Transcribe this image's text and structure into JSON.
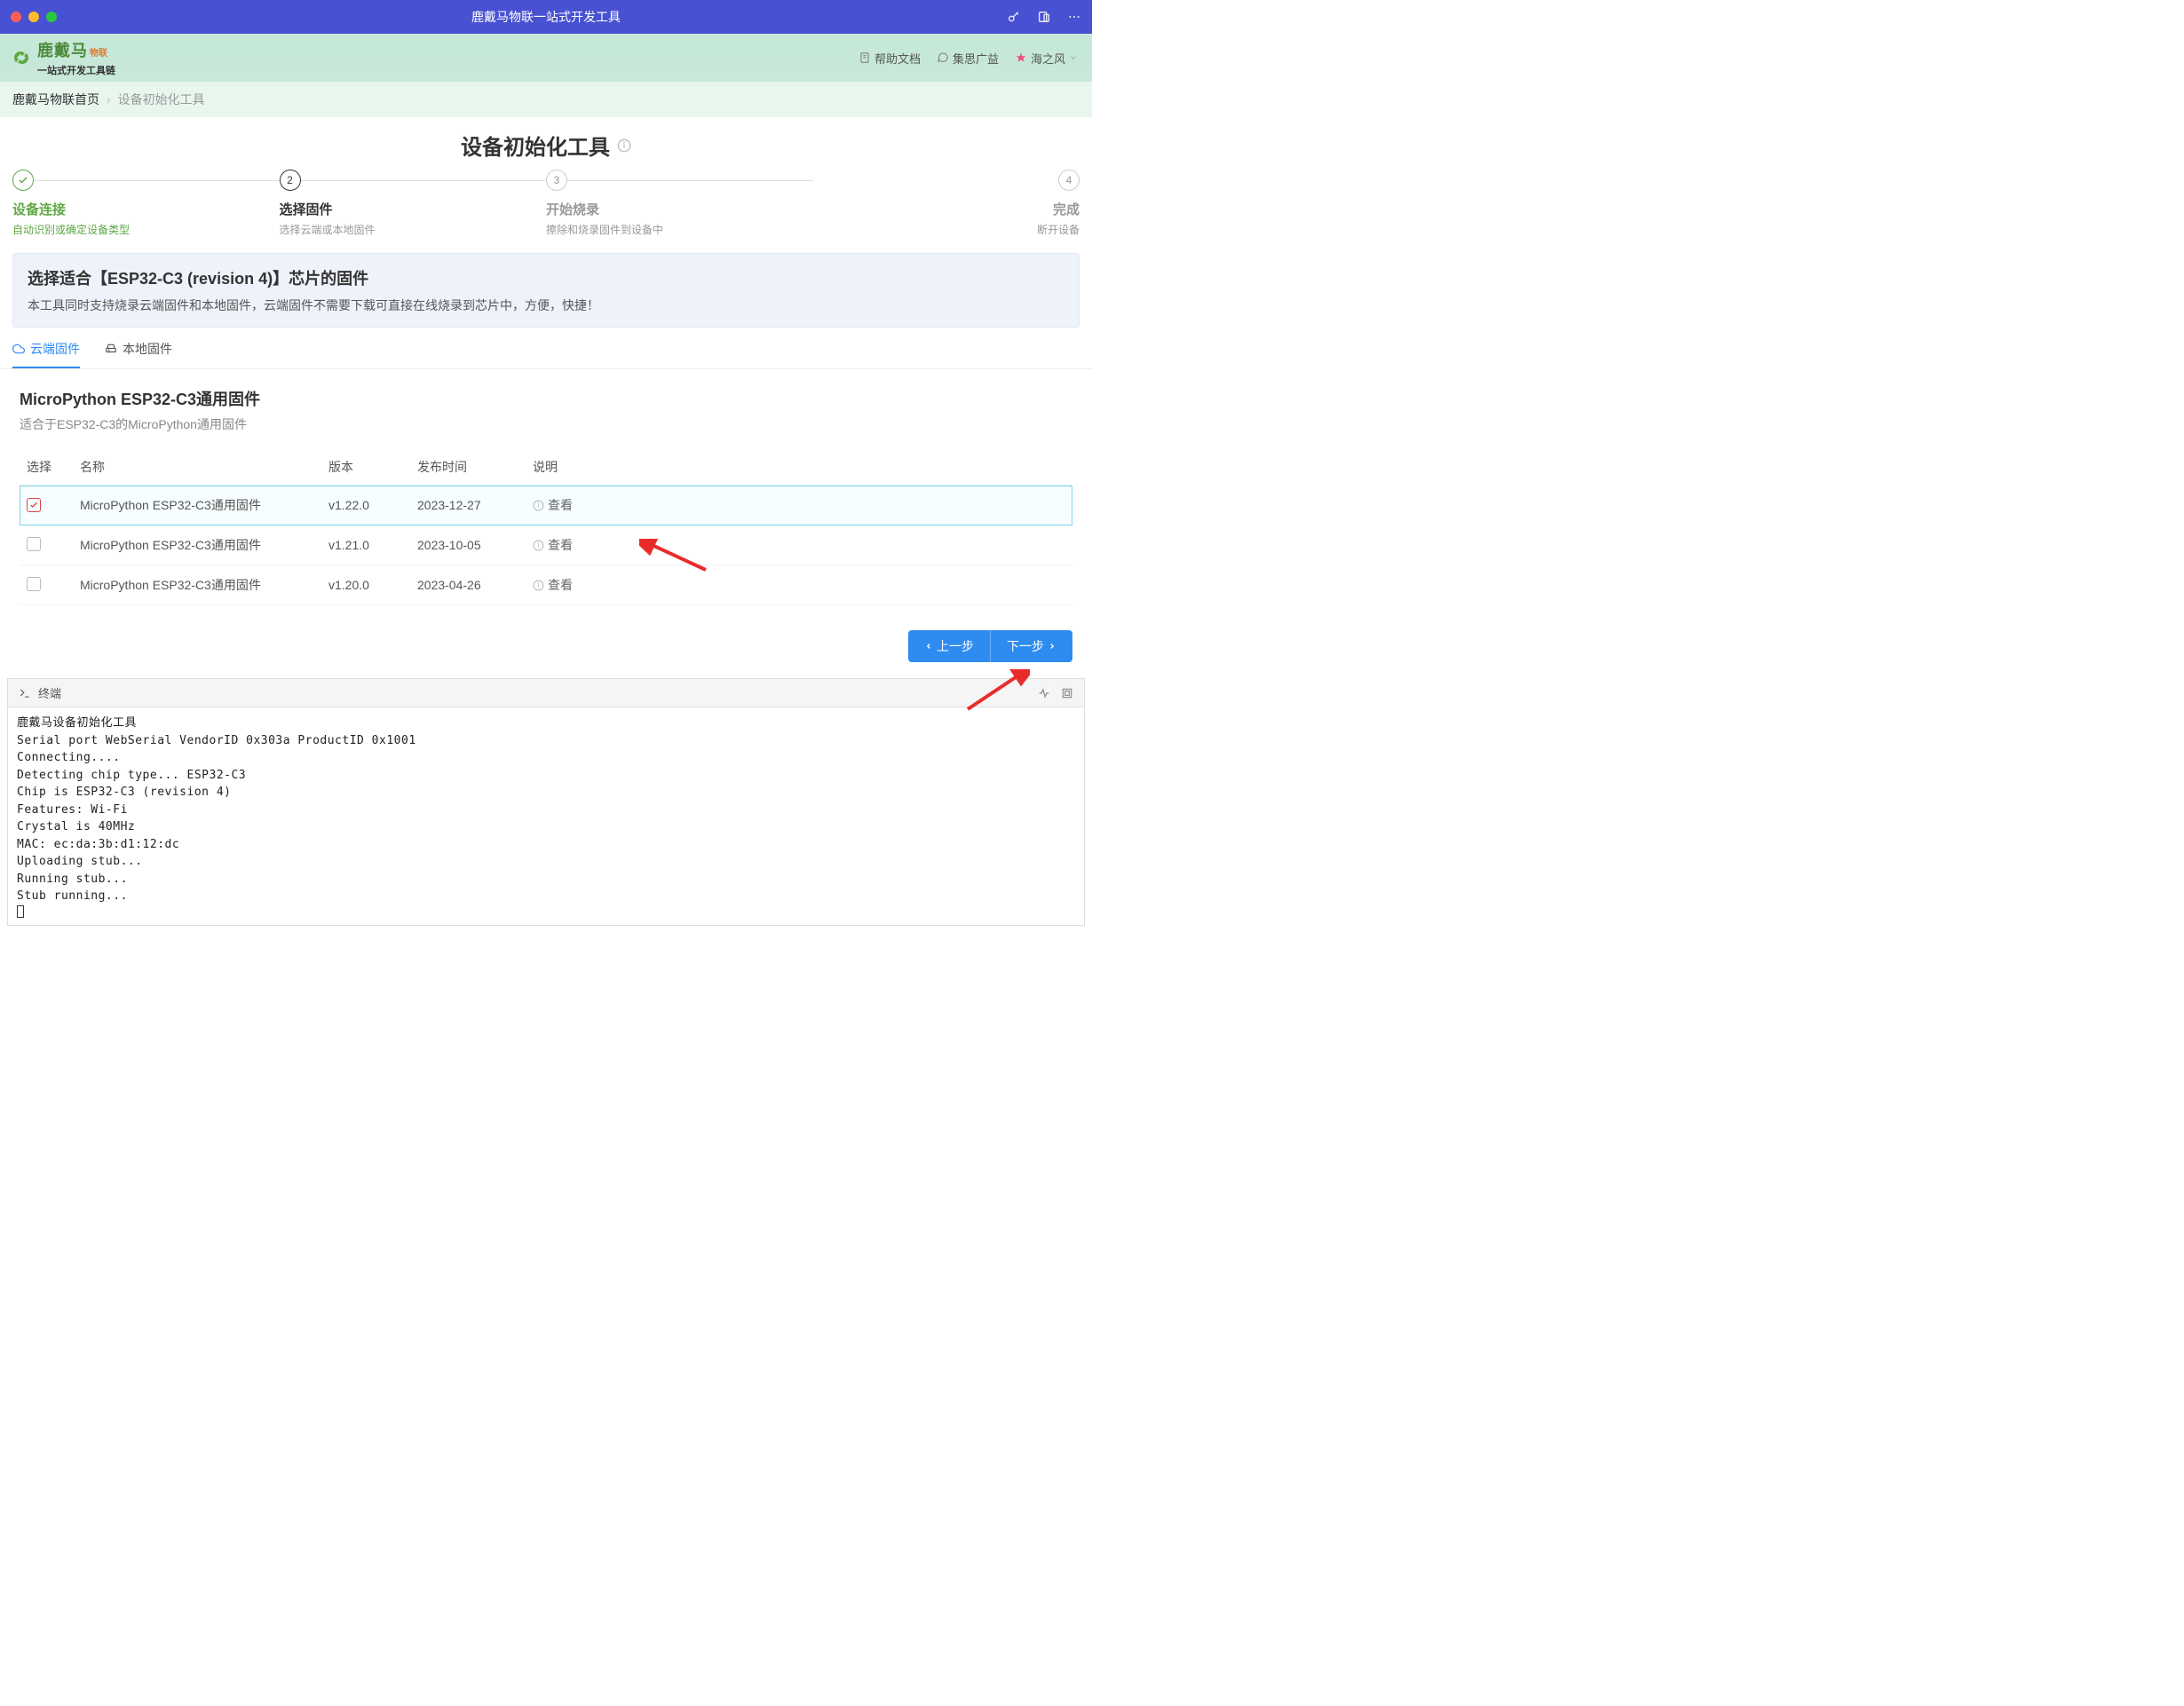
{
  "window": {
    "title": "鹿戴马物联一站式开发工具"
  },
  "header": {
    "brand_main": "鹿戴马",
    "brand_sub": "物联",
    "tagline": "一站式开发工具链",
    "links": {
      "help": "帮助文档",
      "community": "集思广益"
    },
    "user": "海之风"
  },
  "breadcrumb": {
    "home": "鹿戴马物联首页",
    "current": "设备初始化工具"
  },
  "page_title": "设备初始化工具",
  "steps": [
    {
      "num": "",
      "title": "设备连接",
      "desc": "自动识别或确定设备类型",
      "state": "done"
    },
    {
      "num": "2",
      "title": "选择固件",
      "desc": "选择云端或本地固件",
      "state": "active"
    },
    {
      "num": "3",
      "title": "开始烧录",
      "desc": "擦除和烧录固件到设备中",
      "state": "todo"
    },
    {
      "num": "4",
      "title": "完成",
      "desc": "断开设备",
      "state": "todo"
    }
  ],
  "alert": {
    "title": "选择适合【ESP32-C3 (revision 4)】芯片的固件",
    "desc": "本工具同时支持烧录云端固件和本地固件，云端固件不需要下载可直接在线烧录到芯片中，方便，快捷！"
  },
  "tabs": {
    "cloud": "云端固件",
    "local": "本地固件"
  },
  "firmware": {
    "title": "MicroPython ESP32-C3通用固件",
    "desc": "适合于ESP32-C3的MicroPython通用固件",
    "columns": {
      "select": "选择",
      "name": "名称",
      "version": "版本",
      "date": "发布时间",
      "desc": "说明"
    },
    "view_label": "查看",
    "rows": [
      {
        "name": "MicroPython ESP32-C3通用固件",
        "version": "v1.22.0",
        "date": "2023-12-27",
        "selected": true
      },
      {
        "name": "MicroPython ESP32-C3通用固件",
        "version": "v1.21.0",
        "date": "2023-10-05",
        "selected": false
      },
      {
        "name": "MicroPython ESP32-C3通用固件",
        "version": "v1.20.0",
        "date": "2023-04-26",
        "selected": false
      }
    ]
  },
  "actions": {
    "prev": "上一步",
    "next": "下一步"
  },
  "terminal": {
    "title": "终端",
    "lines": "鹿戴马设备初始化工具\nSerial port WebSerial VendorID 0x303a ProductID 0x1001\nConnecting....\nDetecting chip type... ESP32-C3\nChip is ESP32-C3 (revision 4)\nFeatures: Wi-Fi\nCrystal is 40MHz\nMAC: ec:da:3b:d1:12:dc\nUploading stub...\nRunning stub...\nStub running..."
  }
}
